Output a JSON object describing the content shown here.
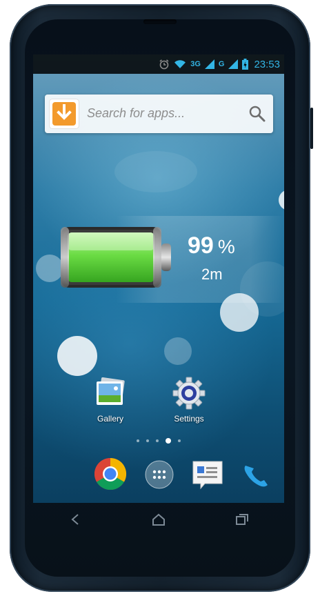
{
  "status_bar": {
    "network_1": "3G",
    "network_2": "G",
    "time": "23:53"
  },
  "search": {
    "placeholder": "Search for apps...",
    "logo_icon": "download-arrow-icon"
  },
  "battery_widget": {
    "percent": "99",
    "unit": "%",
    "time_remaining": "2m",
    "charge_level": 0.99
  },
  "apps": [
    {
      "label": "Gallery",
      "icon": "gallery-icon"
    },
    {
      "label": "Settings",
      "icon": "gear-icon"
    }
  ],
  "page_indicator": {
    "count": 5,
    "active_index": 3
  },
  "dock": [
    {
      "icon": "chrome-icon"
    },
    {
      "icon": "app-drawer-icon"
    },
    {
      "icon": "messaging-icon"
    },
    {
      "icon": "phone-icon"
    }
  ],
  "nav": [
    {
      "icon": "back-icon"
    },
    {
      "icon": "home-icon"
    },
    {
      "icon": "recents-icon"
    }
  ],
  "colors": {
    "accent": "#33b5e5",
    "battery_green": "#5ed143"
  }
}
